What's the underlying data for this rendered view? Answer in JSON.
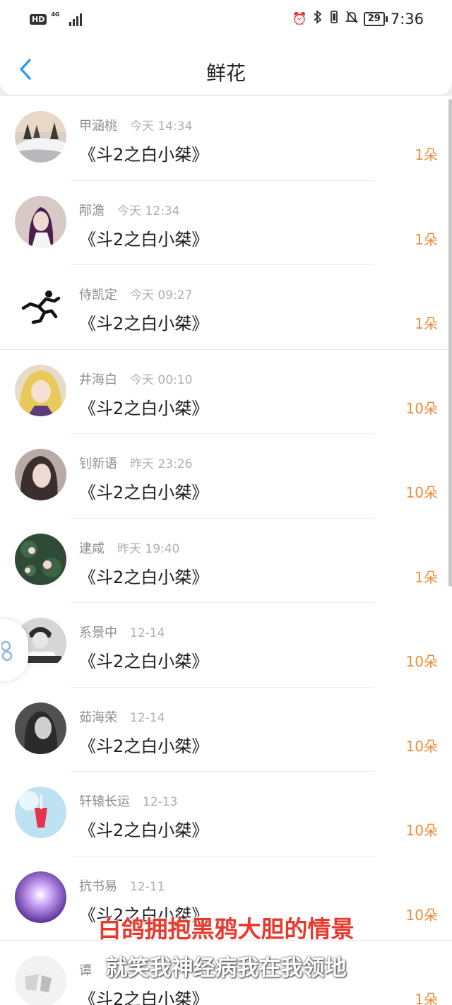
{
  "status_bar": {
    "hd": "HD",
    "network": "4G",
    "battery": "29",
    "time": "7:36",
    "icons": [
      "alarm-icon",
      "bluetooth-icon",
      "vibrate-icon",
      "mute-icon"
    ]
  },
  "header": {
    "back_icon": "chevron-left-icon",
    "title": "鲜花"
  },
  "colors": {
    "accent_blue": "#2b9af3",
    "amount_orange": "#f08a3a"
  },
  "items": [
    {
      "user": "甲涵桃",
      "time": "今天 14:34",
      "book": "《斗2之白小桀》",
      "amount": "1朵",
      "avatar": "snowy-forest-avatar"
    },
    {
      "user": "邴澹",
      "time": "今天 12:34",
      "book": "《斗2之白小桀》",
      "amount": "1朵",
      "avatar": "girl-purple-hair-avatar"
    },
    {
      "user": "侍凯定",
      "time": "今天 09:27",
      "book": "《斗2之白小桀》",
      "amount": "1朵",
      "avatar": "running-man-avatar"
    },
    {
      "user": "井海白",
      "time": "今天 00:10",
      "book": "《斗2之白小桀》",
      "amount": "10朵",
      "avatar": "anime-girl-avatar"
    },
    {
      "user": "钊新语",
      "time": "昨天 23:26",
      "book": "《斗2之白小桀》",
      "amount": "10朵",
      "avatar": "woman-portrait-avatar"
    },
    {
      "user": "逮咸",
      "time": "昨天 19:40",
      "book": "《斗2之白小桀》",
      "amount": "1朵",
      "avatar": "lotus-pond-avatar"
    },
    {
      "user": "系景中",
      "time": "12-14",
      "book": "《斗2之白小桀》",
      "amount": "10朵",
      "avatar": "boy-bw-avatar"
    },
    {
      "user": "茹海荣",
      "time": "12-14",
      "book": "《斗2之白小桀》",
      "amount": "10朵",
      "avatar": "woman-bw-avatar"
    },
    {
      "user": "轩辕长运",
      "time": "12-13",
      "book": "《斗2之白小桀》",
      "amount": "10朵",
      "avatar": "drink-cup-avatar"
    },
    {
      "user": "抗书易",
      "time": "12-11",
      "book": "《斗2之白小桀》",
      "amount": "10朵",
      "avatar": "purple-light-avatar"
    },
    {
      "user": "谭",
      "time": "",
      "book": "《斗2之白小桀》",
      "amount": "1朵",
      "avatar": "abstract-gray-avatar"
    }
  ],
  "overlay_subtitles": {
    "line1": "白鸽拥抱黑鸦大胆的情景",
    "line2": "就笑我神经病我在我领地"
  }
}
